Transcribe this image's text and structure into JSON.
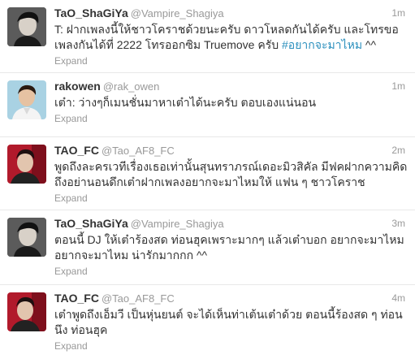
{
  "tweets": [
    {
      "name": "TaO_ShaGiYa",
      "handle": "@Vampire_Shagiya",
      "time": "1m",
      "line1": "T: ฝากเพลงนี้ให้ชาวโคราชด้วยนะครับ ดาวโหลดกันได้ครับ และโทรขอ",
      "line2_text": "เพลงกันได้ที่ 2222 โทรออกซิม Truemove ครับ ",
      "line2_hashtag": "#อยากจะมาไหม",
      "line2_tail": " ^^",
      "expand": "Expand",
      "avatar": "avatar-man-dark-hair"
    },
    {
      "name": "rakowen",
      "handle": "@rak_owen",
      "time": "1m",
      "line1": "เต๋า: ว่างๆก็เมนชั่นมาหาเต๋าได้นะครับ ตอบเองแน่นอน",
      "expand": "Expand",
      "avatar": "avatar-man-white-shirt"
    },
    {
      "name": "TAO_FC",
      "handle": "@Tao_AF8_FC",
      "time": "2m",
      "line1": "พูดถึงละครเวทีเรื่องเธอเท่านั้นสุนทราภรณ์เดอะมิวสิคัล มีฟคฝากความคิด",
      "line2": "ถึงอย่านอนดึกเต๋าฝากเพลงอยากจะมาไหมให้ แฟน ๆ ชาวโคราช",
      "expand": "Expand",
      "avatar": "avatar-man-red-background"
    },
    {
      "name": "TaO_ShaGiYa",
      "handle": "@Vampire_Shagiya",
      "time": "3m",
      "line1": "ตอนนี้ DJ ให้เต๋าร้องสด ท่อนฮุคเพราะมากๆ แล้วเต๋าบอก อยากจะมาไหม",
      "line2": "อยากจะมาไหม น่ารักมากกก ^^",
      "expand": "Expand",
      "avatar": "avatar-man-dark-hair"
    },
    {
      "name": "TAO_FC",
      "handle": "@Tao_AF8_FC",
      "time": "4m",
      "line1": "เต๋าพูดถึงเอ็มวี เป็นหุ่นยนต์ จะได้เห็นท่าเต้นเต๋าด้วย ตอนนี้ร้องสด ๆ ท่อน",
      "line2": "นึง ท่อนฮุค",
      "expand": "Expand",
      "avatar": "avatar-man-red-background"
    }
  ],
  "colors": {
    "name": "#333333",
    "meta": "#999999",
    "hashtag": "#2a8fbd",
    "divider": "#e8e8e8"
  }
}
